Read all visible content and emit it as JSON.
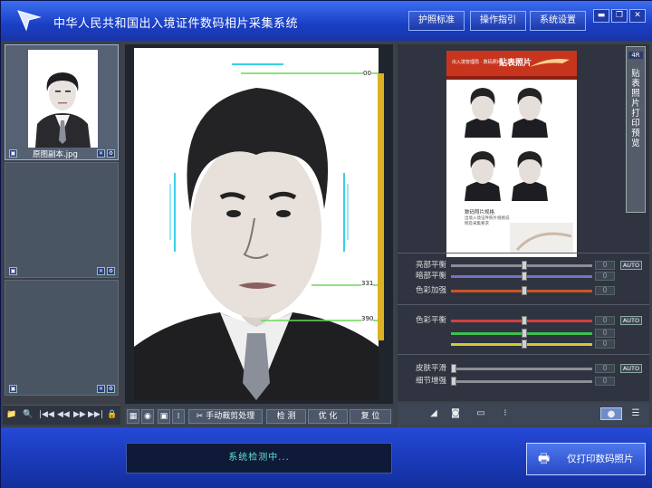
{
  "app": {
    "title": "中华人民共和国出入境证件数码相片采集系统"
  },
  "header": {
    "menu": [
      {
        "label": "护照标准"
      },
      {
        "label": "操作指引"
      },
      {
        "label": "系统设置"
      }
    ],
    "window_controls": [
      "minimize-icon",
      "restore-icon",
      "close-icon"
    ]
  },
  "left_panel": {
    "thumbnails": [
      {
        "filename": "原图副本.jpg",
        "has_image": true
      },
      {
        "filename": "",
        "has_image": false
      },
      {
        "filename": "",
        "has_image": false
      }
    ],
    "toolbar": [
      "open-folder-icon",
      "search-icon",
      "first-page-icon",
      "prev-page-icon",
      "next-page-icon",
      "last-page-icon",
      "lock-icon"
    ]
  },
  "center": {
    "ruler_labels": [
      "00",
      "331",
      "390"
    ],
    "toolbar": {
      "manual_label": "手动裁剪处理",
      "detect_label": "检 测",
      "optimize_label": "优 化",
      "reset_label": "复 位"
    }
  },
  "right_panel": {
    "vertical_tab": {
      "tag": "4R",
      "label": "贴表照片打印预览"
    },
    "preview": {
      "header_small": "出入境管理局 · 数码照片",
      "header_title": "贴表照片",
      "footer_title": "数码照片规格",
      "footer_text": "出境入境证件照片规格说明及采集要求"
    },
    "sliders": [
      {
        "label": "亮部平衡",
        "value": "0",
        "level": 0.52,
        "color": "#8a8f97",
        "auto": true
      },
      {
        "label": "暗部平衡",
        "value": "0",
        "level": 0.52,
        "color": "#7a6fc8",
        "auto": false
      },
      {
        "label": "色彩加强",
        "value": "0",
        "level": 0.52,
        "color": "#c8552a",
        "auto": false
      },
      {
        "label": "色彩平衡",
        "value": "0",
        "level": 0.52,
        "color": "#d04040",
        "auto": true
      },
      {
        "label": "",
        "value": "0",
        "level": 0.52,
        "color": "#3fbf4f",
        "auto": false
      },
      {
        "label": "",
        "value": "0",
        "level": 0.52,
        "color": "#d8c830",
        "auto": false
      },
      {
        "label": "皮肤平滑",
        "value": "0",
        "level": 0.0,
        "color": "#8a8f97",
        "auto": true
      },
      {
        "label": "细节增强",
        "value": "0",
        "level": 0.0,
        "color": "#8a8f97",
        "auto": false
      }
    ],
    "auto_label": "AUTO",
    "toolbar": [
      "eraser-icon",
      "camera-icon",
      "monitor-icon",
      "info-icon",
      "grid-view-icon",
      "list-view-icon"
    ]
  },
  "status": {
    "text": "系统检测中..."
  },
  "print_button": {
    "label": "仅打印数码照片"
  }
}
